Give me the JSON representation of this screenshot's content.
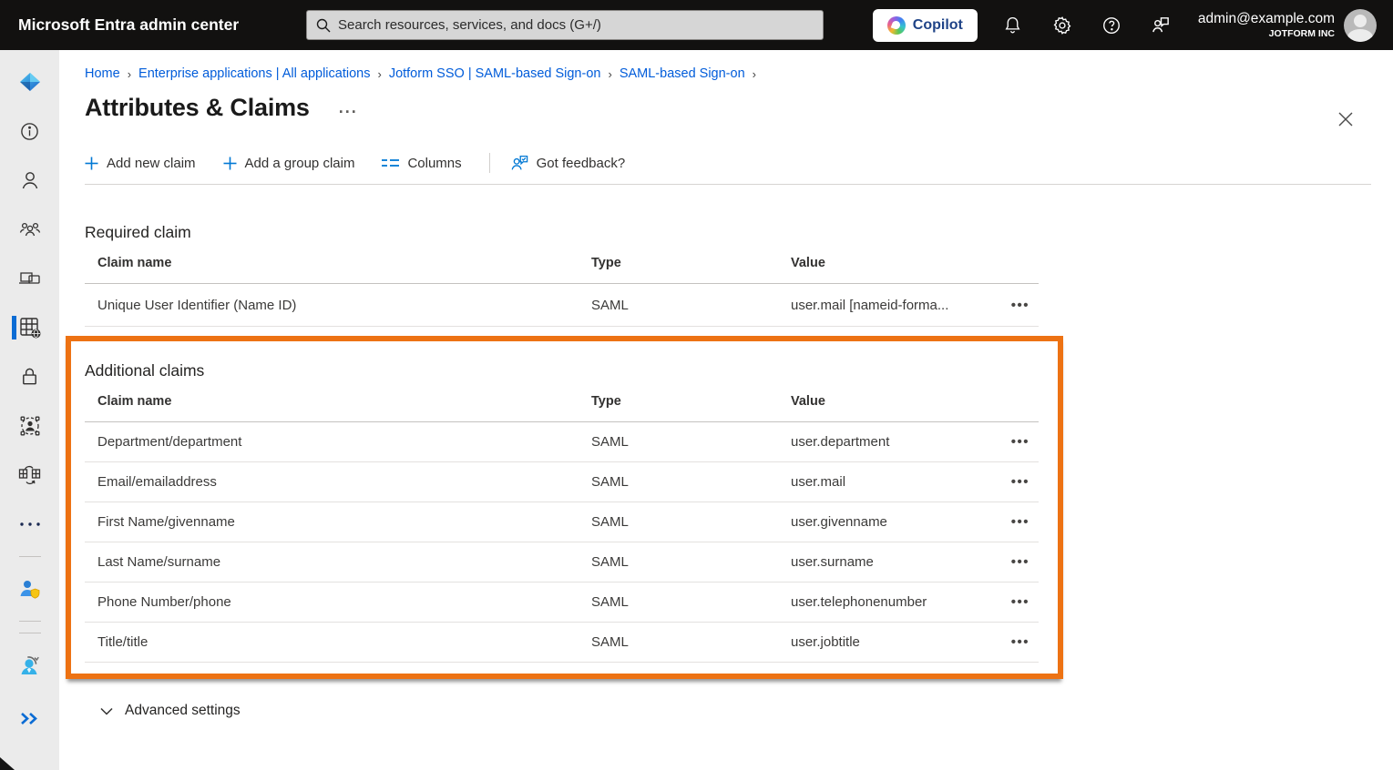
{
  "colors": {
    "topbar_bg": "#121110",
    "accent_blue": "#0078d4",
    "link_blue": "#015cda",
    "highlight_orange": "#ed7213",
    "sidebar_bg": "#ebebeb"
  },
  "topbar": {
    "title": "Microsoft Entra admin center",
    "search_placeholder": "Search resources, services, and docs (G+/)",
    "copilot_label": "Copilot",
    "account_email": "admin@example.com",
    "account_org": "JOTFORM INC"
  },
  "breadcrumb": {
    "separator": "›",
    "items": [
      "Home",
      "Enterprise applications | All applications",
      "Jotform SSO | SAML-based Sign-on",
      "SAML-based Sign-on"
    ]
  },
  "page": {
    "title": "Attributes & Claims",
    "overflow_icon": "···"
  },
  "toolbar": {
    "add_new_claim": "Add new claim",
    "add_group_claim": "Add a group claim",
    "columns": "Columns",
    "got_feedback": "Got feedback?"
  },
  "table_common": {
    "actions_icon": "•••",
    "columns": [
      "Claim name",
      "Type",
      "Value"
    ]
  },
  "required_claim": {
    "heading": "Required claim",
    "rows": [
      {
        "claim_name": "Unique User Identifier (Name ID)",
        "type": "SAML",
        "value": "user.mail [nameid-forma..."
      }
    ]
  },
  "additional_claims": {
    "heading": "Additional claims",
    "rows": [
      {
        "claim_name": "Department/department",
        "type": "SAML",
        "value": "user.department"
      },
      {
        "claim_name": "Email/emailaddress",
        "type": "SAML",
        "value": "user.mail"
      },
      {
        "claim_name": "First Name/givenname",
        "type": "SAML",
        "value": "user.givenname"
      },
      {
        "claim_name": "Last Name/surname",
        "type": "SAML",
        "value": "user.surname"
      },
      {
        "claim_name": "Phone Number/phone",
        "type": "SAML",
        "value": "user.telephonenumber"
      },
      {
        "claim_name": "Title/title",
        "type": "SAML",
        "value": "user.jobtitle"
      }
    ]
  },
  "advanced_settings": {
    "label": "Advanced settings"
  },
  "sidebar_icon_names": [
    "entra-logo",
    "info",
    "user",
    "users-group",
    "devices",
    "enterprise-apps",
    "lock",
    "identity-governance",
    "cross-tenant-sync",
    "show-more",
    "protection-user",
    "learn-support-user",
    "expand"
  ]
}
